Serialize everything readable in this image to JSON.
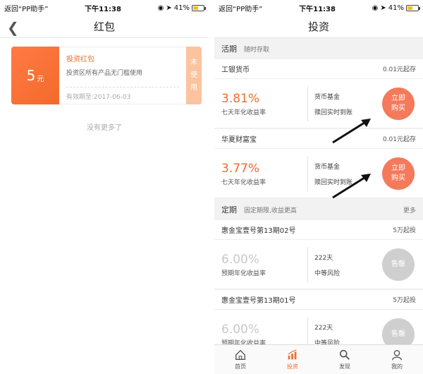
{
  "status": {
    "back": "返回“PP助手”",
    "time": "下午11:38",
    "battery": "41%"
  },
  "left": {
    "title": "红包",
    "coupon": {
      "amount": "5",
      "unit": "元",
      "name": "投资红包",
      "desc": "投资区所有产品无门槛使用",
      "expiry": "有效期至:2017-06-03",
      "status_char1": "未",
      "status_char2": "使",
      "status_char3": "用"
    },
    "no_more": "没有更多了"
  },
  "right": {
    "title": "投资",
    "current": {
      "label": "活期",
      "sub": "随时存取"
    },
    "products": [
      {
        "name": "工银货币",
        "min": "0.01元起存",
        "rate": "3.81%",
        "rate_label": "七天年化收益率",
        "info1": "货币基金",
        "info2": "赎回实时到账",
        "btn1": "立即",
        "btn2": "购买"
      },
      {
        "name": "华夏财富宝",
        "min": "0.01元起存",
        "rate": "3.77%",
        "rate_label": "七天年化收益率",
        "info1": "货币基金",
        "info2": "赎回实时到账",
        "btn1": "立即",
        "btn2": "购买"
      }
    ],
    "fixed": {
      "label": "定期",
      "sub": "固定期限,收益更高",
      "more": "更多"
    },
    "fixed_products": [
      {
        "name": "惠金宝壹号第13期02号",
        "min": "5万起投",
        "rate": "6.00%",
        "rate_label": "预期年化收益率",
        "info1": "222天",
        "info2": "中等风险",
        "btn": "售罄"
      },
      {
        "name": "惠金宝壹号第13期01号",
        "min": "5万起投",
        "rate": "6.00%",
        "rate_label": "预期年化收益率",
        "info1": "222天",
        "info2": "中等风险",
        "btn": "售罄"
      }
    ],
    "tabs": [
      {
        "label": "首页",
        "icon": "home-icon"
      },
      {
        "label": "投资",
        "icon": "chart-icon"
      },
      {
        "label": "发现",
        "icon": "search-icon"
      },
      {
        "label": "我的",
        "icon": "user-icon"
      }
    ]
  },
  "colors": {
    "accent": "#f36a2a",
    "button": "#f47a5b",
    "sold": "#cfcfcf"
  }
}
